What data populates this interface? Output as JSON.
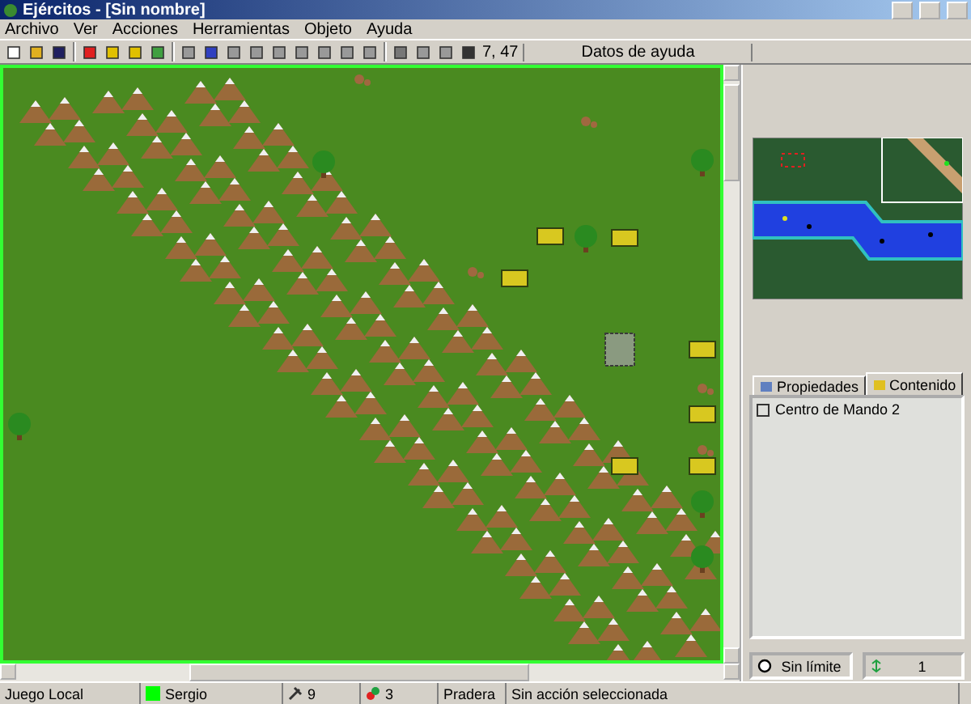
{
  "window": {
    "title": "Ejércitos - [Sin nombre]"
  },
  "menu": [
    {
      "label": "Archivo"
    },
    {
      "label": "Ver"
    },
    {
      "label": "Acciones"
    },
    {
      "label": "Herramientas"
    },
    {
      "label": "Objeto"
    },
    {
      "label": "Ayuda"
    }
  ],
  "toolbar": {
    "coordinates": "7, 47",
    "help": "Datos de ayuda"
  },
  "tabs": [
    {
      "label": "Propiedades",
      "selected": false
    },
    {
      "label": "Contenido",
      "selected": true
    }
  ],
  "content_list": [
    {
      "label": "Centro de Mando 2"
    }
  ],
  "panel_footer": {
    "limit": "Sin límite",
    "count": "1"
  },
  "status_bar": {
    "mode": "Juego Local",
    "player": "Sergio",
    "tools": "9",
    "resources": "3",
    "terrain": "Pradera",
    "action": "Sin acción seleccionada"
  }
}
